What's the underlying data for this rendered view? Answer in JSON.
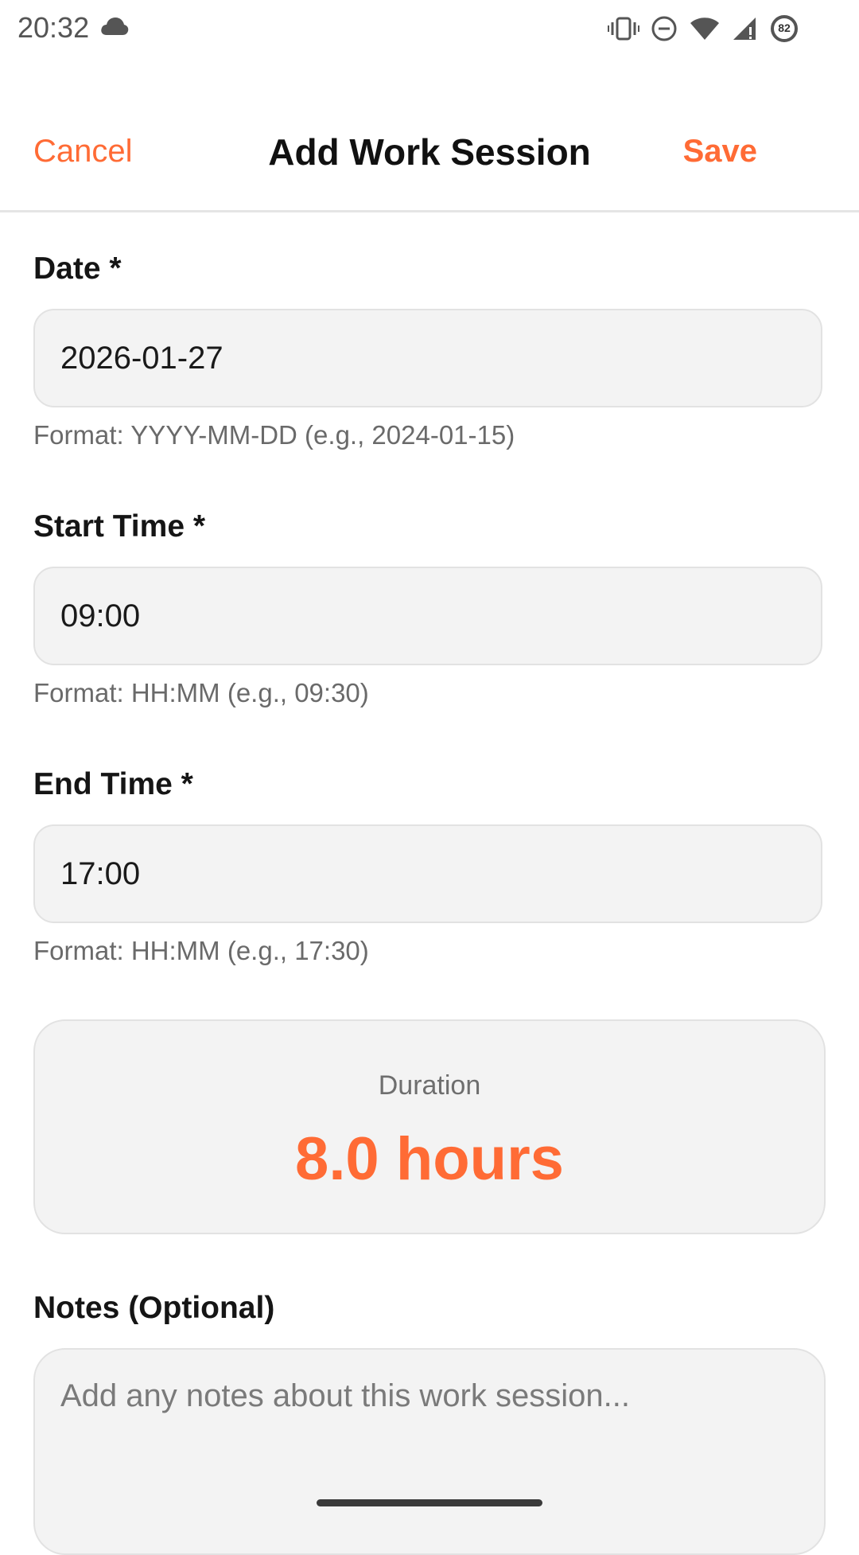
{
  "status_bar": {
    "time": "20:32",
    "battery_level": "82",
    "icons": [
      "cloud-icon",
      "vibrate-icon",
      "do-not-disturb-icon",
      "wifi-icon",
      "signal-icon",
      "battery-icon"
    ]
  },
  "header": {
    "cancel_label": "Cancel",
    "title": "Add Work Session",
    "save_label": "Save"
  },
  "form": {
    "date": {
      "label": "Date *",
      "value": "2026-01-27",
      "hint": "Format: YYYY-MM-DD (e.g., 2024-01-15)"
    },
    "start_time": {
      "label": "Start Time *",
      "value": "09:00",
      "hint": "Format: HH:MM (e.g., 09:30)"
    },
    "end_time": {
      "label": "End Time *",
      "value": "17:00",
      "hint": "Format: HH:MM (e.g., 17:30)"
    },
    "duration": {
      "label": "Duration",
      "value": "8.0 hours"
    },
    "notes": {
      "label": "Notes (Optional)",
      "placeholder": "Add any notes about this work session..."
    }
  },
  "colors": {
    "accent": "#ff6b35",
    "field_bg": "#f3f3f3",
    "hint_text": "#6a6a6a"
  }
}
